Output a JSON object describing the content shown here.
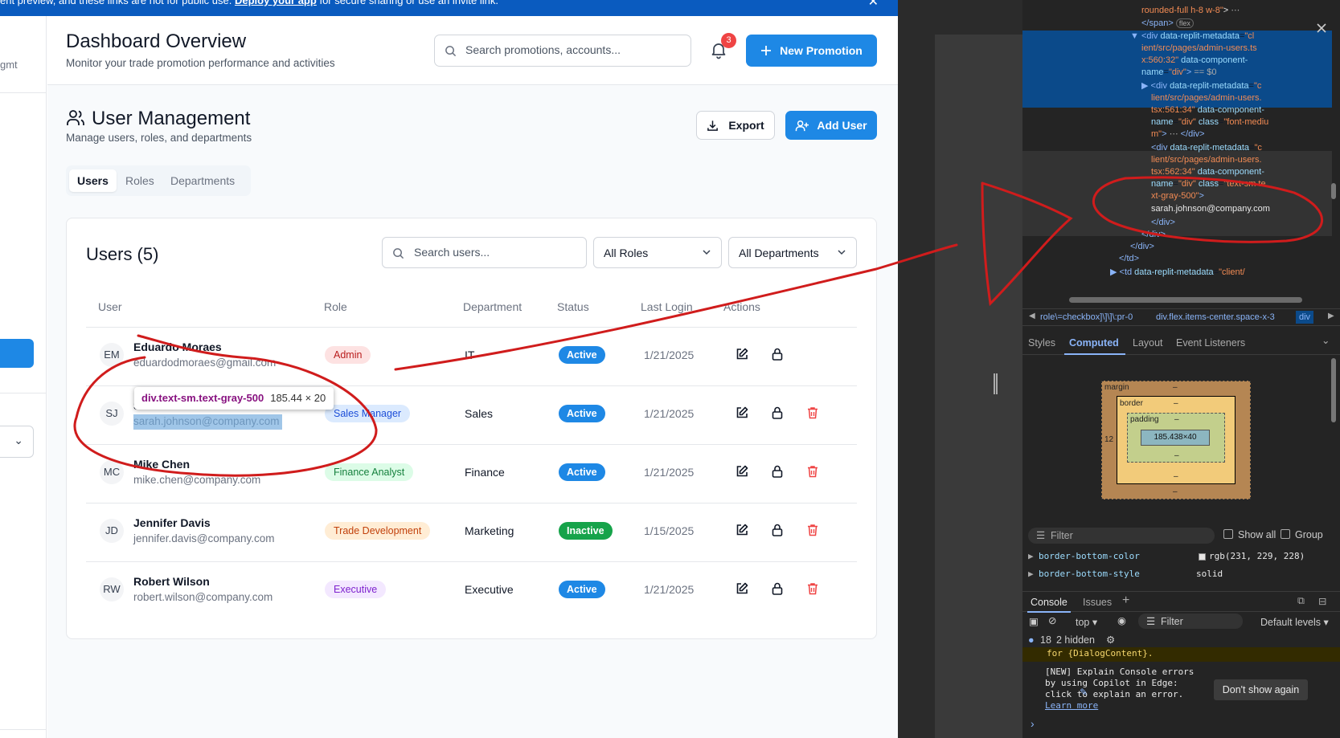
{
  "banner": {
    "text": "ent preview, and these links are not for public use.",
    "link": "Deploy your app",
    "tail": "for secure sharing or use an invite link.",
    "close": "✕"
  },
  "sidebar": {
    "fragment": "gmt"
  },
  "header": {
    "title": "Dashboard Overview",
    "subtitle": "Monitor your trade promotion performance and activities",
    "search_placeholder": "Search promotions, accounts...",
    "notification_count": "3",
    "new_button": "New Promotion"
  },
  "section": {
    "title": "User Management",
    "subtitle": "Manage users, roles, and departments",
    "export": "Export",
    "add_user": "Add User"
  },
  "tabs": [
    "Users",
    "Roles",
    "Departments"
  ],
  "users_card": {
    "title": "Users (5)",
    "search_placeholder": "Search users...",
    "role_filter": "All Roles",
    "dept_filter": "All Departments",
    "columns": [
      "User",
      "Role",
      "Department",
      "Status",
      "Last Login",
      "Actions"
    ]
  },
  "users": [
    {
      "initials": "EM",
      "name": "Eduardo Moraes",
      "email": "eduardodmoraes@gmail.com",
      "role": "Admin",
      "department": "IT",
      "status": "Active",
      "last_login": "1/21/2025",
      "deletable": false
    },
    {
      "initials": "SJ",
      "name": "Sarah Johnson",
      "email": "sarah.johnson@company.com",
      "role": "Sales Manager",
      "department": "Sales",
      "status": "Active",
      "last_login": "1/21/2025",
      "deletable": true
    },
    {
      "initials": "MC",
      "name": "Mike Chen",
      "email": "mike.chen@company.com",
      "role": "Finance Analyst",
      "department": "Finance",
      "status": "Active",
      "last_login": "1/21/2025",
      "deletable": true
    },
    {
      "initials": "JD",
      "name": "Jennifer Davis",
      "email": "jennifer.davis@company.com",
      "role": "Trade Development",
      "department": "Marketing",
      "status": "Inactive",
      "last_login": "1/15/2025",
      "deletable": true
    },
    {
      "initials": "RW",
      "name": "Robert Wilson",
      "email": "robert.wilson@company.com",
      "role": "Executive",
      "department": "Executive",
      "status": "Active",
      "last_login": "1/21/2025",
      "deletable": true
    }
  ],
  "role_colors": {
    "Admin": {
      "bg": "#fde2e2",
      "fg": "#b91c1c"
    },
    "Sales Manager": {
      "bg": "#dbeafe",
      "fg": "#1d4ed8"
    },
    "Finance Analyst": {
      "bg": "#dcfce7",
      "fg": "#15803d"
    },
    "Trade Development": {
      "bg": "#ffedd5",
      "fg": "#c2410c"
    },
    "Executive": {
      "bg": "#f3e8ff",
      "fg": "#7e22ce"
    }
  },
  "status_colors": {
    "Active": "#1e88e5",
    "Inactive": "#16a34a"
  },
  "inspector_tooltip": {
    "selector": "div.text-sm.text-gray-500",
    "size": "185.44 × 20"
  },
  "devtools": {
    "code_lines": [
      {
        "html": "<span class='tok-val'>rounded-full h-8 w-8\"</span><span class='tok-txt'>&gt;</span> <span style='color:#aaa'>⋯</span>"
      },
      {
        "html": "<span class='tok-tag'>&lt;/span&gt;</span> <span style='color:#aaa;border:1px solid #666;border-radius:6px;padding:0 3px;font-size:9px'>flex</span>"
      },
      {
        "html": "<span class='tok-tag'>▼ &lt;div </span><span class='tok-attr'>data-replit-metadata</span>=<span class='tok-val'>\"cl</span>"
      },
      {
        "html": "<span class='tok-val'>ient/src/pages/admin-users.ts</span>"
      },
      {
        "html": "<span class='tok-val'>x:560:32\"</span> <span class='tok-attr'>data-component-</span>"
      },
      {
        "html": "<span class='tok-attr'>name</span>=<span class='tok-val'>\"div\"</span><span class='tok-tag'>&gt;</span> <span style='color:#aaa'>== $0</span>"
      },
      {
        "html": "<span class='tok-tag'>▶ &lt;div </span><span class='tok-attr'>data-replit-metadata</span>=<span class='tok-val'>\"c</span>"
      },
      {
        "html": "<span class='tok-val'>lient/src/pages/admin-users.</span>"
      },
      {
        "html": "<span class='tok-val'>tsx:561:34\"</span> <span class='tok-attr'>data-component-</span>"
      },
      {
        "html": "<span class='tok-attr'>name</span>=<span class='tok-val'>\"div\"</span> <span class='tok-attr'>class</span>=<span class='tok-val'>\"font-mediu</span>"
      },
      {
        "html": "<span class='tok-val'>m\"</span><span class='tok-tag'>&gt;</span> <span style='color:#aaa'>⋯</span> <span class='tok-tag'>&lt;/div&gt;</span>"
      },
      {
        "html": "<span class='tok-tag'>&lt;div </span><span class='tok-attr'>data-replit-metadata</span>=<span class='tok-val'>\"c</span>"
      },
      {
        "html": "<span class='tok-val'>lient/src/pages/admin-users.</span>"
      },
      {
        "html": "<span class='tok-val'>tsx:562:34\"</span> <span class='tok-attr'>data-component-</span>"
      },
      {
        "html": "<span class='tok-attr'>name</span>=<span class='tok-val'>\"div\"</span> <span class='tok-attr'>class</span>=<span class='tok-val'>\"text-sm te</span>"
      },
      {
        "html": "<span class='tok-val'>xt-gray-500\"</span><span class='tok-tag'>&gt;</span>"
      },
      {
        "html": "<span class='tok-txt'>sarah.johnson@company.com</span>"
      },
      {
        "html": "<span class='tok-tag'>&lt;/div&gt;</span>"
      },
      {
        "html": "<span class='tok-tag'>&lt;/div&gt;</span>"
      },
      {
        "html": "<span class='tok-tag'>&lt;/div&gt;</span>"
      },
      {
        "html": "<span class='tok-tag'>&lt;/td&gt;</span>"
      },
      {
        "html": "<span class='tok-tag'>▶ &lt;td </span><span class='tok-attr'>data-replit-metadata</span>=<span class='tok-val'>\"client/</span>"
      }
    ],
    "breadcrumb": [
      "role\\=checkbox]\\]\\]\\:pr-0",
      "div.flex.items-center.space-x-3",
      "div"
    ],
    "tabs": [
      "Styles",
      "Computed",
      "Layout",
      "Event Listeners"
    ],
    "box_model": {
      "margin": "margin",
      "border": "border",
      "padding": "padding",
      "content": "185.438×40",
      "left_margin": "12",
      "dash": "–"
    },
    "filter_placeholder": "Filter",
    "show_all": "Show all",
    "group": "Group",
    "properties": [
      {
        "name": "border-bottom-color",
        "value": "rgb(231, 229, 228)"
      },
      {
        "name": "border-bottom-style",
        "value": "solid"
      }
    ],
    "console_tabs": [
      "Console",
      "Issues"
    ],
    "console_top": "top",
    "console_filter": "Filter",
    "default_levels": "Default levels",
    "message_count": "18",
    "hidden_count": "2 hidden",
    "warn_text": "for {DialogContent}.",
    "copilot_lines": [
      "[NEW] Explain Console errors",
      "by using Copilot in Edge:",
      "click      to explain an error."
    ],
    "learn_more": "Learn more",
    "dont_show": "Don't show again",
    "prompt": "›"
  }
}
